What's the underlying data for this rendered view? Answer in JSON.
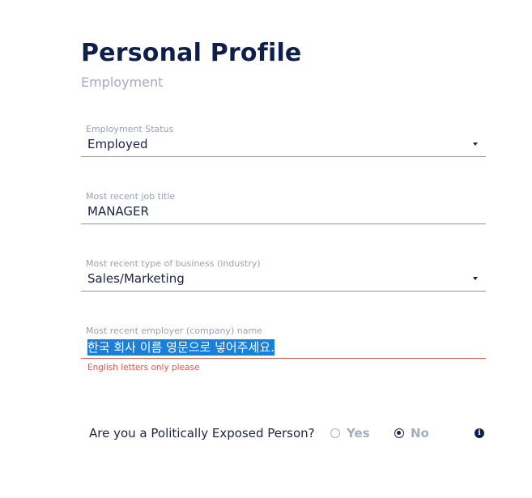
{
  "header": {
    "title": "Personal Profile",
    "subtitle": "Employment"
  },
  "fields": {
    "employment_status": {
      "label": "Employment Status",
      "value": "Employed"
    },
    "job_title": {
      "label": "Most recent job title",
      "value": "MANAGER"
    },
    "business_type": {
      "label": "Most recent type of business (industry)",
      "value": "Sales/Marketing"
    },
    "employer_name": {
      "label": "Most recent employer (company) name",
      "value": "한국 회사 이름 영문으로 넣어주세요.",
      "error": "English letters only please"
    }
  },
  "pep": {
    "question": "Are you a Politically Exposed Person?",
    "options": [
      {
        "label": "Yes",
        "selected": false
      },
      {
        "label": "No",
        "selected": true
      }
    ],
    "info_icon": "info-icon"
  },
  "colors": {
    "title": "#0f1f4b",
    "subtitle": "#a3abbd",
    "error": "#e0544b",
    "selection": "#1a7fd8"
  }
}
